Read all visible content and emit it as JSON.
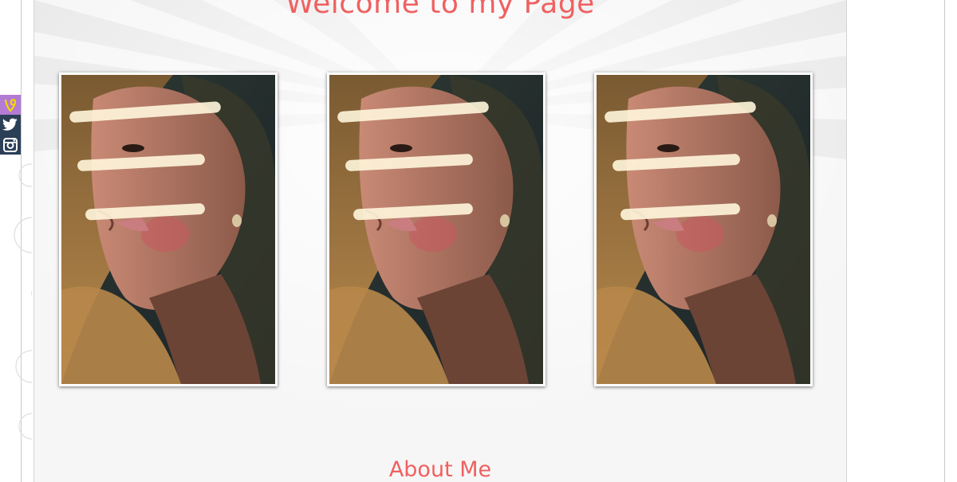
{
  "page": {
    "title": "Welcome to my Page",
    "about_heading": "About Me"
  },
  "gallery": {
    "photos": [
      {
        "alt": "portrait-photo"
      },
      {
        "alt": "portrait-photo"
      },
      {
        "alt": "portrait-photo"
      }
    ]
  },
  "social": [
    {
      "icon": "vine-icon",
      "color": "#b37bd3"
    },
    {
      "icon": "twitter-icon",
      "color": "#2b3f57"
    },
    {
      "icon": "instagram-icon",
      "color": "#2b3f57"
    }
  ],
  "colors": {
    "heading": "#f06060",
    "background": "#f6f6f6",
    "frame": "#ffffff"
  }
}
